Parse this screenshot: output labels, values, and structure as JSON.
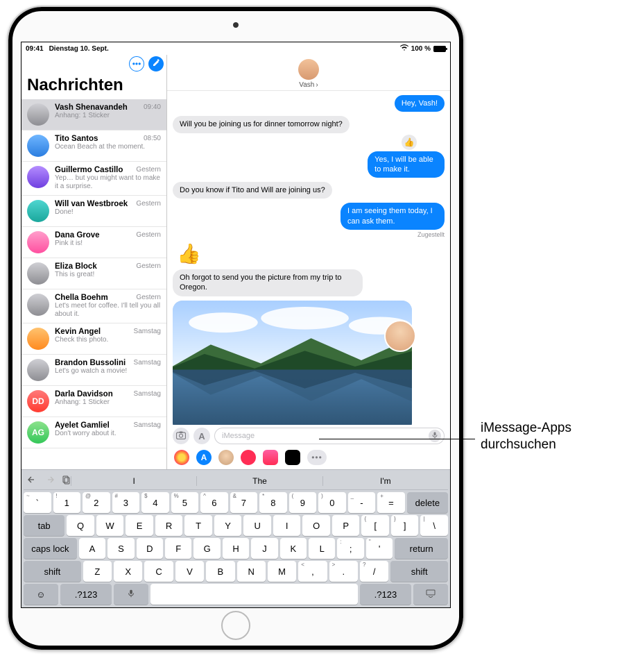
{
  "statusbar": {
    "time": "09:41",
    "date": "Dienstag 10. Sept.",
    "battery": "100 %"
  },
  "sidebar": {
    "title": "Nachrichten",
    "conversations": [
      {
        "name": "Vash Shenavandeh",
        "time": "09:40",
        "preview": "Anhang: 1 Sticker",
        "selected": true,
        "initials": "",
        "avclass": "av-gray"
      },
      {
        "name": "Tito Santos",
        "time": "08:50",
        "preview": "Ocean Beach at the moment.",
        "avclass": "av-blue"
      },
      {
        "name": "Guillermo Castillo",
        "time": "Gestern",
        "preview": "Yep… but you might want to make it a surprise.",
        "avclass": "av-purple"
      },
      {
        "name": "Will van Westbroek",
        "time": "Gestern",
        "preview": "Done!",
        "avclass": "av-teal"
      },
      {
        "name": "Dana Grove",
        "time": "Gestern",
        "preview": "Pink it is!",
        "avclass": "av-pink"
      },
      {
        "name": "Eliza Block",
        "time": "Gestern",
        "preview": "This is great!",
        "avclass": "av-gray"
      },
      {
        "name": "Chella Boehm",
        "time": "Gestern",
        "preview": "Let's meet for coffee. I'll tell you all about it.",
        "avclass": "av-gray"
      },
      {
        "name": "Kevin Angel",
        "time": "Samstag",
        "preview": "Check this photo.",
        "avclass": "av-orange"
      },
      {
        "name": "Brandon Bussolini",
        "time": "Samstag",
        "preview": "Let's go watch a movie!",
        "avclass": "av-gray"
      },
      {
        "name": "Darla Davidson",
        "time": "Samstag",
        "preview": "Anhang: 1 Sticker",
        "initials": "DD",
        "avclass": "av-red"
      },
      {
        "name": "Ayelet Gamliel",
        "time": "Samstag",
        "preview": "Don't worry about it.",
        "initials": "AG",
        "avclass": "av-green"
      }
    ]
  },
  "chat": {
    "contact_name": "Vash",
    "messages": {
      "m1": "Hey, Vash!",
      "m2": "Will you be joining us for dinner tomorrow night?",
      "m3": "Yes, I will be able to make it.",
      "m4": "Do you know if Tito and Will are joining us?",
      "m5": "I am seeing them today, I can ask them.",
      "delivery": "Zugestellt",
      "emoji": "👍",
      "m6": "Oh forgot to send you the picture from my trip to Oregon."
    },
    "input_placeholder": "iMessage"
  },
  "appdrawer": {
    "photos": "photos-icon",
    "appstore": "appstore-icon",
    "memoji": "memoji-icon",
    "search": "images-search-icon",
    "music": "music-icon",
    "animoji": "animoji-icon",
    "more": "•••"
  },
  "keyboard": {
    "suggestions": [
      "I",
      "The",
      "I'm"
    ],
    "num_row": [
      {
        "main": "`",
        "sub": "~"
      },
      {
        "main": "1",
        "sub": "!"
      },
      {
        "main": "2",
        "sub": "@"
      },
      {
        "main": "3",
        "sub": "#"
      },
      {
        "main": "4",
        "sub": "$"
      },
      {
        "main": "5",
        "sub": "%"
      },
      {
        "main": "6",
        "sub": "^"
      },
      {
        "main": "7",
        "sub": "&"
      },
      {
        "main": "8",
        "sub": "*"
      },
      {
        "main": "9",
        "sub": "("
      },
      {
        "main": "0",
        "sub": ")"
      },
      {
        "main": "-",
        "sub": "_"
      },
      {
        "main": "=",
        "sub": "+"
      }
    ],
    "delete": "delete",
    "q_row": [
      "Q",
      "W",
      "E",
      "R",
      "T",
      "Y",
      "U",
      "I",
      "O",
      "P"
    ],
    "q_tail": [
      {
        "main": "[",
        "sub": "{"
      },
      {
        "main": "]",
        "sub": "}"
      },
      {
        "main": "\\",
        "sub": "|"
      }
    ],
    "tab": "tab",
    "caps": "caps lock",
    "a_row": [
      "A",
      "S",
      "D",
      "F",
      "G",
      "H",
      "J",
      "K",
      "L"
    ],
    "a_tail": [
      {
        "main": ";",
        "sub": ":"
      },
      {
        "main": "'",
        "sub": "\""
      }
    ],
    "return": "return",
    "shift": "shift",
    "z_row": [
      "Z",
      "X",
      "C",
      "V",
      "B",
      "N",
      "M"
    ],
    "z_tail": [
      {
        "main": ",",
        "sub": "<"
      },
      {
        "main": ".",
        "sub": ">"
      },
      {
        "main": "/",
        "sub": "?"
      }
    ],
    "bottom": {
      "numtoggle": ".?123"
    }
  },
  "callout": {
    "line1": "iMessage-Apps",
    "line2": "durchsuchen"
  }
}
